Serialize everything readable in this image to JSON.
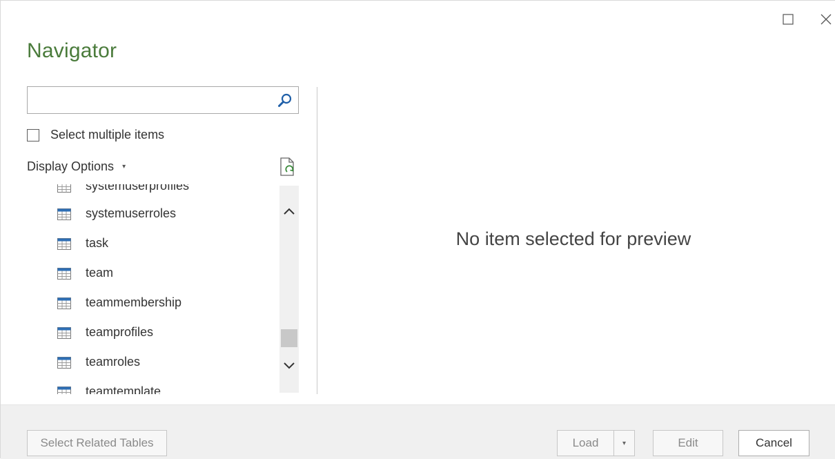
{
  "window": {
    "title": "Navigator",
    "maximize_icon": "maximize-icon",
    "close_icon": "close-icon"
  },
  "search": {
    "value": "",
    "placeholder": "",
    "icon": "search-icon"
  },
  "select_multiple": {
    "label": "Select multiple items",
    "checked": false
  },
  "display_options": {
    "label": "Display Options",
    "caret": "▾",
    "refresh_icon": "refresh-document-icon"
  },
  "tables": [
    "systemuserprofiles",
    "systemuserroles",
    "task",
    "team",
    "teammembership",
    "teamprofiles",
    "teamroles",
    "teamtemplate"
  ],
  "preview": {
    "message": "No item selected for preview"
  },
  "footer": {
    "select_related_label": "Select Related Tables",
    "load_label": "Load",
    "load_dropdown": "▾",
    "edit_label": "Edit",
    "cancel_label": "Cancel"
  },
  "colors": {
    "title_green": "#4a7b3b",
    "table_icon_blue": "#2e6fb5"
  }
}
